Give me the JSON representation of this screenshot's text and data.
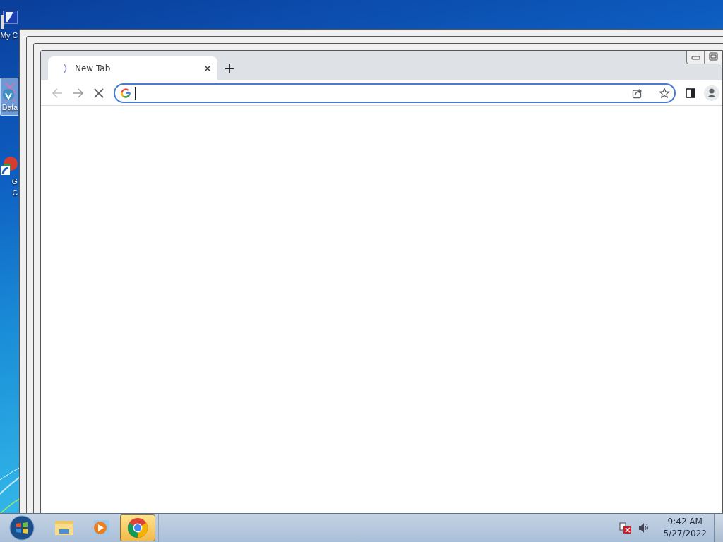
{
  "desktop_icons": [
    {
      "kind": "computer",
      "lines": [
        "My C"
      ],
      "selected": false
    },
    {
      "kind": "data",
      "lines": [
        "Data"
      ],
      "selected": true
    },
    {
      "kind": "shortcut",
      "lines": [
        "G",
        "C"
      ],
      "selected": false
    }
  ],
  "browser": {
    "tab": {
      "title": "New Tab"
    },
    "loading": true
  },
  "taskbar": {
    "items": [
      {
        "kind": "explorer",
        "active": false
      },
      {
        "kind": "media",
        "active": false
      },
      {
        "kind": "chrome",
        "active": true
      }
    ],
    "clock": {
      "time": "9:42 AM",
      "date": "5/27/2022"
    }
  }
}
